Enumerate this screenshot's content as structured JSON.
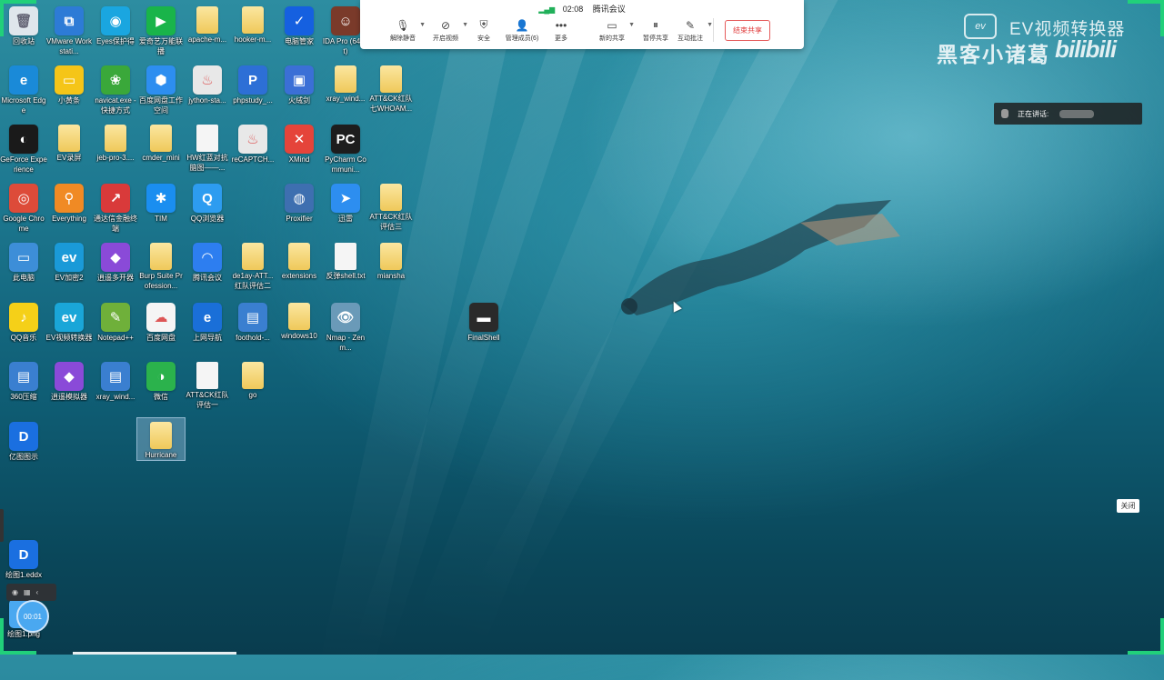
{
  "meeting_bar": {
    "time": "02:08",
    "title": "腾讯会议",
    "tools": [
      {
        "label": "解除静音",
        "icon": "mic-muted-icon",
        "has_menu": true
      },
      {
        "label": "开启视频",
        "icon": "camera-off-icon",
        "has_menu": true
      },
      {
        "label": "安全",
        "icon": "shield-icon",
        "has_menu": false
      },
      {
        "label": "管理成员(6)",
        "icon": "members-icon",
        "has_menu": false
      },
      {
        "label": "更多",
        "icon": "more-icon",
        "has_menu": false
      },
      {
        "label": "新的共享",
        "icon": "screen-share-icon",
        "has_menu": true
      },
      {
        "label": "暂停共享",
        "icon": "pause-icon",
        "has_menu": false
      },
      {
        "label": "互动批注",
        "icon": "annotate-icon",
        "has_menu": true
      }
    ],
    "end_share": "结束共享"
  },
  "watermark": {
    "ev_logo": "ev",
    "ev_text": "EV视频转换器",
    "author": "黑客小诸葛",
    "site": "bilibili"
  },
  "speaking": {
    "label": "正在讲话:"
  },
  "close_button": "关闭",
  "recorder": {
    "timer": "00:01"
  },
  "desktop_icons": [
    {
      "label": "回收站",
      "type": "recycle",
      "color": "#dfe6ec"
    },
    {
      "label": "VMware Workstati...",
      "type": "app",
      "color": "#2d7bd6",
      "glyph": "⧉"
    },
    {
      "label": "Eyes保护得",
      "type": "app",
      "color": "#1aa6e0",
      "glyph": "◉"
    },
    {
      "label": "爱奇艺万能联播",
      "type": "app",
      "color": "#19b44a",
      "glyph": "▶"
    },
    {
      "label": "apache-m...",
      "type": "folder"
    },
    {
      "label": "hooker-m...",
      "type": "folder"
    },
    {
      "label": "电脑管家",
      "type": "app",
      "color": "#1560e0",
      "glyph": "✓"
    },
    {
      "label": "IDA Pro (64-bit)",
      "type": "app",
      "color": "#7a3a2a",
      "glyph": "☺"
    },
    {
      "label": "Microsoft Edge",
      "type": "app",
      "color": "#1a8ad8",
      "glyph": "e"
    },
    {
      "label": "小黄条",
      "type": "app",
      "color": "#f5c518",
      "glyph": "▭"
    },
    {
      "label": "navicat.exe - 快捷方式",
      "type": "app",
      "color": "#3aa83a",
      "glyph": "❀"
    },
    {
      "label": "百度网盘工作空间",
      "type": "app",
      "color": "#2d8ef0",
      "glyph": "⬢"
    },
    {
      "label": "jython-sta...",
      "type": "app",
      "color": "#e8e8e8",
      "glyph": "♨"
    },
    {
      "label": "phpstudy_...",
      "type": "app",
      "color": "#2d6fd6",
      "glyph": "P"
    },
    {
      "label": "火绒剑",
      "type": "app",
      "color": "#3b6fd6",
      "glyph": "▣"
    },
    {
      "label": "xray_wind...",
      "type": "folder"
    },
    {
      "label": "ATT&CK红队七WHOAM...",
      "type": "folder"
    },
    {
      "label": "GeForce Experience",
      "type": "app",
      "color": "#1a1a1a",
      "glyph": "◐"
    },
    {
      "label": "EV录屏",
      "type": "folder"
    },
    {
      "label": "jeb-pro-3....",
      "type": "folder"
    },
    {
      "label": "cmder_mini",
      "type": "folder"
    },
    {
      "label": "HW红蓝对抗脑图——...",
      "type": "doc"
    },
    {
      "label": "reCAPTCH...",
      "type": "app",
      "color": "#e8e8e8",
      "glyph": "♨"
    },
    {
      "label": "XMind",
      "type": "app",
      "color": "#e5443a",
      "glyph": "✕"
    },
    {
      "label": "PyCharm Communi...",
      "type": "app",
      "color": "#1d1d1d",
      "glyph": "PC"
    },
    {
      "label": "Google Chrome",
      "type": "app",
      "color": "#dd4b39",
      "glyph": "◎"
    },
    {
      "label": "Everything",
      "type": "app",
      "color": "#f08a24",
      "glyph": "⚲"
    },
    {
      "label": "通达信金融终端",
      "type": "app",
      "color": "#d93a3a",
      "glyph": "↗"
    },
    {
      "label": "TIM",
      "type": "app",
      "color": "#1a8ef0",
      "glyph": "✱"
    },
    {
      "label": "QQ浏览器",
      "type": "app",
      "color": "#2d9cf0",
      "glyph": "Q"
    },
    {
      "label": "Proxifier",
      "type": "app",
      "color": "#3e6fb0",
      "glyph": "◍"
    },
    {
      "label": "迅雷",
      "type": "app",
      "color": "#2d8ef0",
      "glyph": "➤"
    },
    {
      "label": "ATT&CK红队评估三",
      "type": "folder"
    },
    {
      "label": "此电脑",
      "type": "app",
      "color": "#3d8ed8",
      "glyph": "▭"
    },
    {
      "label": "EV加密2",
      "type": "app",
      "color": "#1a9ad8",
      "glyph": "ev"
    },
    {
      "label": "逍遥多开器",
      "type": "app",
      "color": "#8a4ad8",
      "glyph": "◆"
    },
    {
      "label": "Burp Suite Profession...",
      "type": "folder"
    },
    {
      "label": "腾讯会议",
      "type": "app",
      "color": "#2d7ef0",
      "glyph": "◠"
    },
    {
      "label": "de1ay-ATT...红队评估二",
      "type": "folder"
    },
    {
      "label": "extensions",
      "type": "folder"
    },
    {
      "label": "反弹shell.txt",
      "type": "doc"
    },
    {
      "label": "miansha",
      "type": "folder"
    },
    {
      "label": "QQ音乐",
      "type": "app",
      "color": "#f5d018",
      "glyph": "♪"
    },
    {
      "label": "EV视频转换器",
      "type": "app",
      "color": "#1aa6d8",
      "glyph": "ev"
    },
    {
      "label": "Notepad++",
      "type": "app",
      "color": "#6fb03a",
      "glyph": "✎"
    },
    {
      "label": "百度网盘",
      "type": "app",
      "color": "#f5f5f5",
      "glyph": "☁"
    },
    {
      "label": "上网导航",
      "type": "app",
      "color": "#1a6fd8",
      "glyph": "e"
    },
    {
      "label": "foothold-...",
      "type": "app",
      "color": "#3a7fd0",
      "glyph": "▤"
    },
    {
      "label": "windows10",
      "type": "folder"
    },
    {
      "label": "Nmap - Zenm...",
      "type": "app",
      "color": "#6a9ab8",
      "glyph": "👁"
    },
    {
      "label": "FinalShell",
      "type": "app",
      "color": "#2a2a2a",
      "glyph": "▬"
    },
    {
      "label": "360压缩",
      "type": "app",
      "color": "#3a7fd0",
      "glyph": "▤"
    },
    {
      "label": "逍遥模拟器",
      "type": "app",
      "color": "#8a4ad8",
      "glyph": "◆"
    },
    {
      "label": "xray_wind...",
      "type": "app",
      "color": "#3a7fd0",
      "glyph": "▤"
    },
    {
      "label": "微信",
      "type": "app",
      "color": "#2bb24c",
      "glyph": "◑"
    },
    {
      "label": "ATT&CK红队评估一",
      "type": "doc"
    },
    {
      "label": "go",
      "type": "folder"
    },
    {
      "label": "亿图图示",
      "type": "app",
      "color": "#1a6fe0",
      "glyph": "D"
    },
    {
      "label": "Hurricane",
      "type": "folder"
    },
    {
      "label": "绘图1.eddx",
      "type": "app",
      "color": "#1a6fe0",
      "glyph": "D"
    },
    {
      "label": "绘图1.png",
      "type": "app",
      "color": "#4aa8f0",
      "glyph": "▣"
    }
  ]
}
